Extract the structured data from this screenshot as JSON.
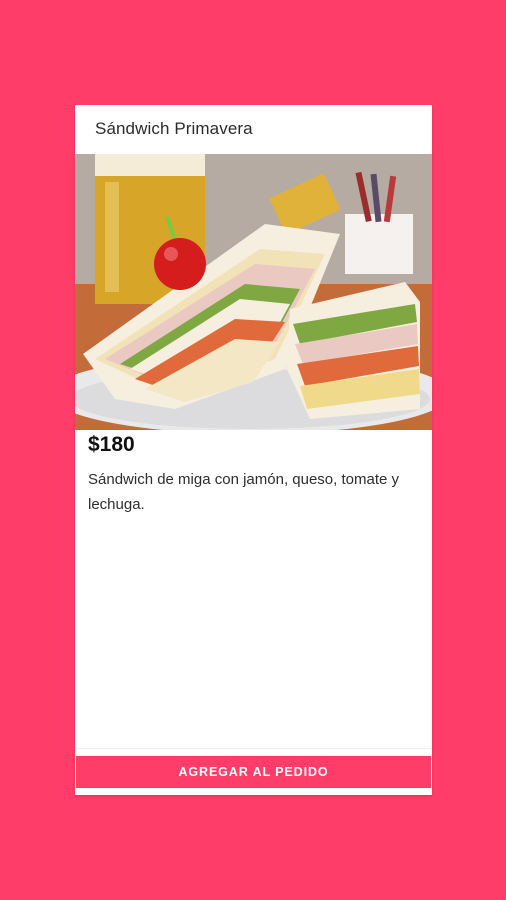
{
  "product": {
    "title": "Sándwich Primavera",
    "price": "$180",
    "description": "Sándwich de miga con jamón, queso, tomate y lechuga.",
    "image": "sandwich-photo"
  },
  "actions": {
    "add_label": "AGREGAR AL PEDIDO"
  },
  "colors": {
    "background": "#ff3d68",
    "accent": "#ff3d68",
    "card": "#ffffff"
  }
}
